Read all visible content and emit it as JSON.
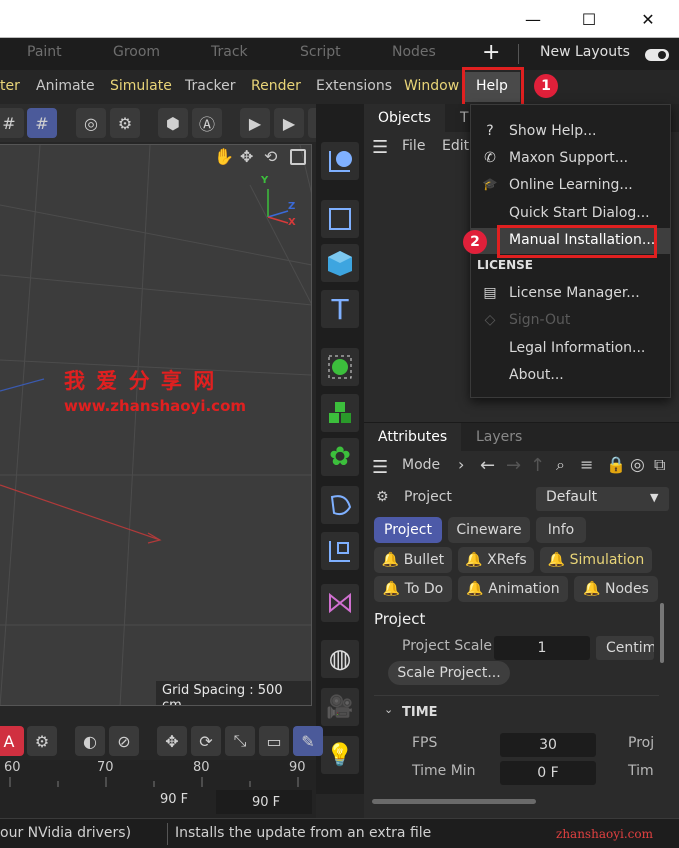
{
  "window": {
    "minimize": "—",
    "maximize": "☐",
    "close": "✕"
  },
  "layout_tabs": [
    "Paint",
    "Groom",
    "Track",
    "Script",
    "Nodes"
  ],
  "layout_bar": {
    "add": "+",
    "new_layouts": "New Layouts"
  },
  "menu": {
    "items": [
      "ter",
      "Animate",
      "Simulate",
      "Tracker",
      "Render",
      "Extensions",
      "Window",
      "Help"
    ],
    "highlight_color": "#e8d478"
  },
  "viewport": {
    "grid_spacing": "Grid Spacing : 500 cm",
    "axis_y": "Y",
    "axis_z": "Z",
    "axis_x": "X",
    "watermark_cn": "我 爱 分 享 网",
    "watermark_url": "www.zhanshaoyi.com"
  },
  "timeline": {
    "ticks": [
      "60",
      "70",
      "80",
      "90"
    ],
    "frame_a": "90 F",
    "frame_b": "90 F"
  },
  "objects_panel": {
    "tab_objects": "Objects",
    "tab_partial": "T",
    "menu_file": "File",
    "menu_edit": "Edit"
  },
  "help_menu": {
    "items": [
      {
        "icon": "?",
        "label": "Show Help...",
        "enabled": true
      },
      {
        "icon": "✆",
        "label": "Maxon Support...",
        "enabled": true
      },
      {
        "icon": "🎓",
        "label": "Online Learning...",
        "enabled": true
      },
      {
        "icon": "",
        "label": "Quick Start Dialog...",
        "enabled": true
      },
      {
        "icon": "",
        "label": "Manual Installation...",
        "enabled": true
      }
    ],
    "section_license": "LICENSE",
    "license_items": [
      {
        "icon": "▤",
        "label": "License Manager...",
        "enabled": true
      },
      {
        "icon": "◇",
        "label": "Sign-Out",
        "enabled": false
      },
      {
        "icon": "",
        "label": "Legal Information...",
        "enabled": true
      },
      {
        "icon": "",
        "label": "About...",
        "enabled": true
      }
    ]
  },
  "annotations": {
    "badge_1": "1",
    "badge_2": "2"
  },
  "attributes_panel": {
    "tab_attributes": "Attributes",
    "tab_layers": "Layers",
    "mode": "Mode",
    "project_label": "Project",
    "preset": "Default",
    "tabs_row1": [
      "Project",
      "Cineware",
      "Info"
    ],
    "tabs_row2": [
      "Bullet",
      "XRefs",
      "Simulation"
    ],
    "tabs_row3": [
      "To Do",
      "Animation",
      "Nodes"
    ],
    "section_title": "Project",
    "project_scale_label": "Project Scale",
    "project_scale_value": "1",
    "project_scale_unit": "Centim",
    "scale_project_button": "Scale Project...",
    "time_section": "TIME",
    "fps_label": "FPS",
    "fps_value": "30",
    "time_min_label": "Time Min",
    "time_min_value": "0 F",
    "right_partial_1": "Proj",
    "right_partial_2": "Tim"
  },
  "status": {
    "left": "our NVidia drivers)",
    "message": "Installs the update from an extra file",
    "watermark": "zhanshaoyi.com"
  }
}
